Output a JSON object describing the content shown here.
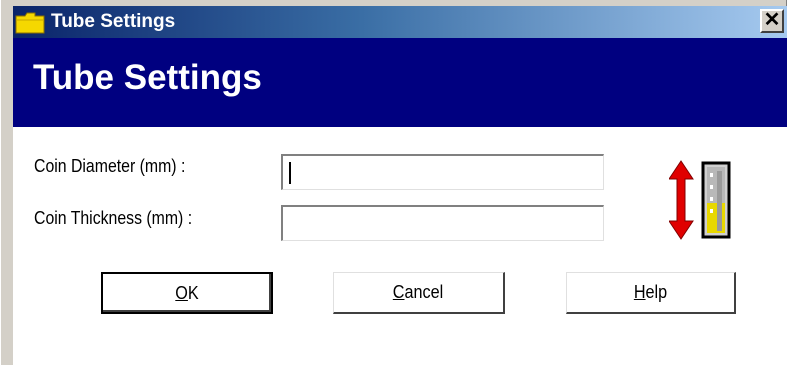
{
  "window": {
    "title": "Tube Settings",
    "close_label": "✕",
    "icon": "folder-icon"
  },
  "banner": {
    "title": "Tube Settings"
  },
  "fields": [
    {
      "label": "Coin Diameter (mm) :",
      "value": "",
      "placeholder": ""
    },
    {
      "label": "Coin Thickness (mm) :",
      "value": "",
      "placeholder": ""
    }
  ],
  "decoration": {
    "icon": "tube-with-arrows-icon",
    "arrow_color": "#e00000",
    "tube_fill_color": "#e8d800"
  },
  "buttons": {
    "ok": {
      "mnemonic": "O",
      "rest": "K"
    },
    "cancel": {
      "mnemonic": "C",
      "rest": "ancel"
    },
    "help": {
      "mnemonic": "H",
      "rest": "elp"
    }
  },
  "colors": {
    "title_gradient_start": "#0a246a",
    "title_gradient_end": "#a6caf0",
    "banner_bg": "#000080",
    "dialog_bg": "#ffffff"
  }
}
